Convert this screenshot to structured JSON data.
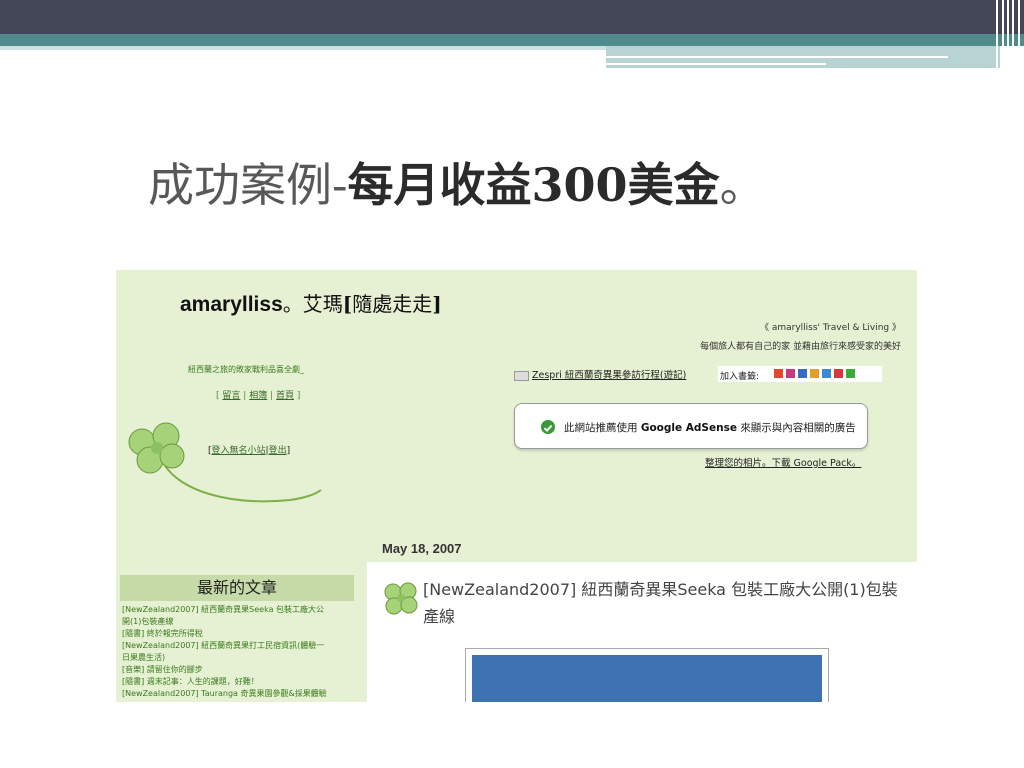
{
  "slide": {
    "title_part1": "成功案例-",
    "title_part2": "每月收益300美金",
    "title_part3": "。"
  },
  "blog": {
    "name": "amarylliss",
    "sep": "。",
    "zh_name": "艾瑪",
    "bracket_open": "[",
    "zh_sub": "隨處走走",
    "bracket_close": "]",
    "tagline": "《 amarylliss' Travel & Living 》",
    "motto": "每個旅人都有自己的家 並藉由旅行來感受家的美好",
    "side_promo": "紐西蘭之旅的敗家戰利品喜全劇_",
    "nav": {
      "open": "[",
      "link1": "留言",
      "sep1": "|",
      "link2": "相簿",
      "sep2": "|",
      "link3": "首頁",
      "close": "]"
    },
    "login": {
      "open": "[",
      "link1": "登入無名小站",
      "sep": "|",
      "link2": "登出",
      "close": "]"
    },
    "zespri_link": "Zespri 紐西蘭奇異果參訪行程(遊記)",
    "bookmark_label": "加入書籤:",
    "adsense_pre": "此網站推薦使用",
    "adsense_brand": "Google AdSense",
    "adsense_post": "來顯示與內容相關的廣告",
    "google_pack": "整理您的相片。下載 Google Pack。",
    "date": "May 18, 2007",
    "recent_heading": "最新的文章",
    "recent_posts": [
      "[NewZealand2007] 紐西蘭奇異果Seeka 包裝工廠大公",
      "開(1)包裝產線",
      "[隨書] 終於報完所得稅",
      "[NewZealand2007] 紐西蘭奇異果打工民宿資訊(體驗一",
      "日果農生活)",
      "[音樂] 請留住你的腳步",
      "[隨書] 週末記事：人生的課題，好難！",
      "[NewZealand2007] Tauranga 奇異果園參觀&採果體驗"
    ],
    "post_title": "[NewZealand2007] 紐西蘭奇異果Seeka 包裝工廠大公開(1)包裝產線"
  },
  "colors": {
    "top_bar": "#434656",
    "teal_bar": "#4f8a8d",
    "blog_bg": "#e6f1d3",
    "recent_head_bg": "#c6dba7"
  }
}
